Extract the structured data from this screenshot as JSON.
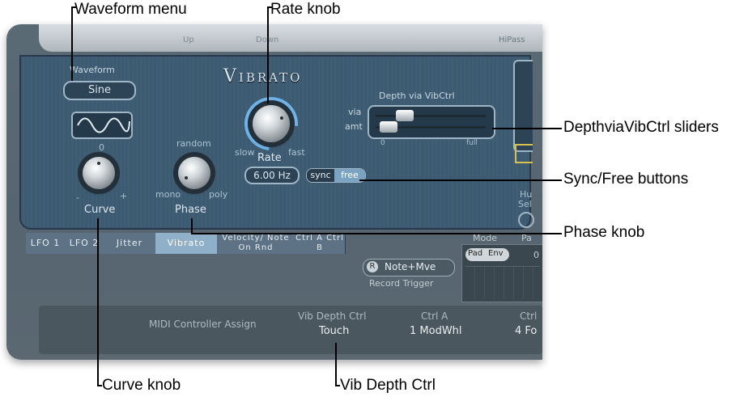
{
  "callouts": {
    "waveform_menu": "Waveform menu",
    "rate_knob": "Rate knob",
    "depth_sliders": "DepthviaVibCtrl sliders",
    "sync_free_buttons": "Sync/Free buttons",
    "phase_knob": "Phase knob",
    "curve_knob": "Curve knob",
    "vib_depth_ctrl": "Vib Depth Ctrl"
  },
  "top_strip": {
    "up": "Up",
    "down": "Down",
    "hipass": "HiPass"
  },
  "vibrato": {
    "title": "Vibrato",
    "waveform_label": "Waveform",
    "waveform_value": "Sine",
    "curve_label": "Curve",
    "curve_minus": "-",
    "curve_plus": "+",
    "curve_zero": "0",
    "phase_label": "Phase",
    "phase_random": "random",
    "phase_mono": "mono",
    "phase_poly": "poly",
    "rate_label": "Rate",
    "rate_slow": "slow",
    "rate_fast": "fast",
    "rate_value": "6.00 Hz",
    "sync_label": "sync",
    "free_label": "free",
    "depth_title": "Depth via VibCtrl",
    "depth_via": "via",
    "depth_amt": "amt",
    "depth_min": "0",
    "depth_max": "full",
    "depth_via_level": 0.22,
    "depth_amt_level": 0.04,
    "hue_label": "Hu",
    "sel_label": "Sel"
  },
  "tabs": [
    {
      "label": "LFO 1",
      "active": false
    },
    {
      "label": "LFO 2",
      "active": false
    },
    {
      "label": "Jitter",
      "active": false
    },
    {
      "label": "Vibrato",
      "active": true
    },
    {
      "label": "Velocity/ Note On Rnd",
      "active": false
    },
    {
      "label": "Ctrl A Ctrl B",
      "active": false
    }
  ],
  "record": {
    "r_button": "R",
    "mode_value": "Note+Mve",
    "label": "Record Trigger"
  },
  "mode_panel": {
    "mode_label": "Mode",
    "pad_label": "Pa",
    "pad_button": "Pad",
    "env_button": "Env",
    "value": "0"
  },
  "midi": {
    "title": "MIDI Controller Assign",
    "col1_label": "Vib Depth Ctrl",
    "col1_value": "Touch",
    "col2_label": "Ctrl A",
    "col2_value": "1 ModWhl",
    "col3_label": "Ctrl",
    "col3_value": "4 Fo"
  },
  "colors": {
    "panel": "#3d5a6e",
    "accent_ring": "#6fb2e6",
    "active_tab": "#8fb0c8"
  }
}
